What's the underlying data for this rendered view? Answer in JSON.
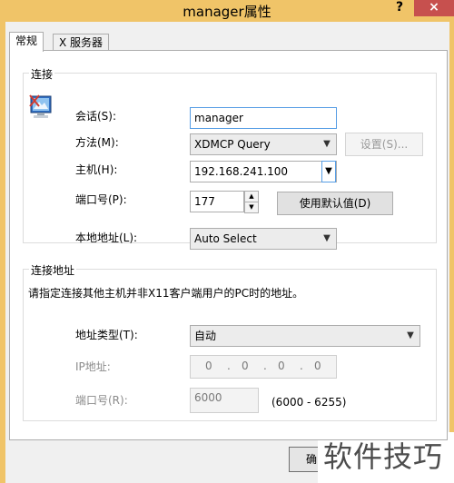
{
  "window": {
    "title": "manager属性",
    "help_glyph": "?",
    "close_glyph": "×"
  },
  "tabs": [
    {
      "label": "常规"
    },
    {
      "label": "X 服务器"
    }
  ],
  "connection": {
    "group_title": "连接",
    "session": {
      "label": "会话(S):",
      "value": "manager"
    },
    "method": {
      "label": "方法(M):",
      "value": "XDMCP Query"
    },
    "settings_button": "设置(S)...",
    "host": {
      "label": "主机(H):",
      "value": "192.168.241.100"
    },
    "port": {
      "label": "端口号(P):",
      "value": "177"
    },
    "default_button": "使用默认值(D)",
    "local_address": {
      "label": "本地地址(L):",
      "value": "Auto Select"
    }
  },
  "connect_address": {
    "group_title": "连接地址",
    "description": "请指定连接其他主机并非X11客户端用户的PC时的地址。",
    "address_type": {
      "label": "地址类型(T):",
      "value": "自动"
    },
    "ip": {
      "label": "IP地址:",
      "segments": [
        "0",
        "0",
        "0",
        "0"
      ]
    },
    "port": {
      "label": "端口号(R):",
      "value": "6000",
      "range": "(6000 - 6255)"
    }
  },
  "footer": {
    "ok_fragment": "确"
  },
  "watermark": "软件技巧"
}
